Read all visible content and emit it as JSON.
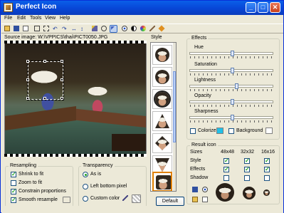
{
  "window": {
    "title": "Perfect Icon"
  },
  "menu": [
    "File",
    "Edit",
    "Tools",
    "View",
    "Help"
  ],
  "toolbar": {
    "icons": [
      "open-icon",
      "save-icon",
      "new-icon",
      "crop-icon",
      "rect-select-icon",
      "rotate-left-icon",
      "rotate-right-icon",
      "flip-horizontal-icon",
      "flip-vertical-icon",
      "magic-wand-icon",
      "zoom-icon",
      "select-icon",
      "eye-icon",
      "contrast-icon",
      "palette-icon",
      "brush-icon",
      "tag-icon"
    ]
  },
  "source": {
    "label": "Source image: W:\\VPPICS\\thai\\PICT0050.JPG"
  },
  "style_panel": {
    "label": "Style",
    "thumbnail_count": 8,
    "default_button": "Default"
  },
  "effects": {
    "label": "Effects",
    "sliders": [
      {
        "name": "Hue",
        "value": 0.5
      },
      {
        "name": "Saturation",
        "value": 0.5
      },
      {
        "name": "Lightness",
        "value": 0.55
      },
      {
        "name": "Opacity",
        "value": 0.5
      },
      {
        "name": "Sharpness",
        "value": 0.5
      }
    ],
    "colorize_label": "Colorize",
    "colorize_checked": false,
    "colorize_color": "#20c0e8",
    "background_label": "Background",
    "background_checked": false,
    "background_color": "#ffffff"
  },
  "result_icon": {
    "label": "Result icon",
    "sizes_label": "Sizes",
    "sizes": [
      "48x48",
      "32x32",
      "16x16"
    ],
    "rows": [
      {
        "label": "Style",
        "checks": [
          true,
          true,
          true
        ]
      },
      {
        "label": "Effects",
        "checks": [
          true,
          true,
          true
        ]
      },
      {
        "label": "Shadow",
        "checks": [
          false,
          false,
          false
        ]
      }
    ]
  },
  "resampling": {
    "label": "Resampling",
    "options": [
      {
        "label": "Shrink to fit",
        "checked": true
      },
      {
        "label": "Zoom to fit",
        "checked": false
      },
      {
        "label": "Constrain proportions",
        "checked": true
      },
      {
        "label": "Smooth resample",
        "checked": true
      }
    ]
  },
  "transparency": {
    "label": "Transparency",
    "options": [
      {
        "label": "As is",
        "selected": true
      },
      {
        "label": "Left bottom pixel",
        "selected": false
      },
      {
        "label": "Custom color",
        "selected": false
      }
    ]
  }
}
